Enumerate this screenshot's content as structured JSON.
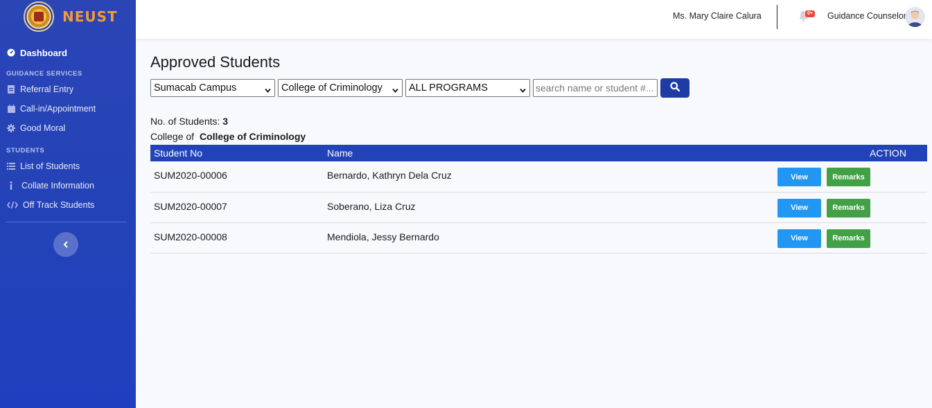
{
  "brand": {
    "name": "NEUST"
  },
  "sidebar": {
    "dashboard": "Dashboard",
    "sections": [
      {
        "heading": "GUIDANCE SERVICES",
        "items": [
          {
            "label": "Referral Entry",
            "icon": "file-icon"
          },
          {
            "label": "Call-in/Appointment",
            "icon": "calendar-icon"
          },
          {
            "label": "Good Moral",
            "icon": "gear-icon"
          }
        ]
      },
      {
        "heading": "STUDENTS",
        "items": [
          {
            "label": "List of Students",
            "icon": "list-icon"
          },
          {
            "label": "Collate Information",
            "icon": "info-icon"
          },
          {
            "label": "Off Track Students",
            "icon": "code-icon"
          }
        ]
      }
    ]
  },
  "topbar": {
    "user_name": "Ms. Mary Claire Calura",
    "notification_badge": "0+",
    "role": "Guidance Counselor"
  },
  "page": {
    "title": "Approved Students",
    "filters": {
      "campus": "Sumacab Campus",
      "college": "College of Criminology",
      "program": "ALL PROGRAMS",
      "search_placeholder": "search name or student #..."
    },
    "count_label": "No. of Students:",
    "count_value": "3",
    "college_label": "College of",
    "college_value": "College of Criminology"
  },
  "table": {
    "headers": {
      "student_no": "Student No",
      "name": "Name",
      "action": "ACTION"
    },
    "view_label": "View",
    "remarks_label": "Remarks",
    "rows": [
      {
        "student_no": "SUM2020-00006",
        "name": "Bernardo, Kathryn Dela Cruz"
      },
      {
        "student_no": "SUM2020-00007",
        "name": "Soberano, Liza Cruz"
      },
      {
        "student_no": "SUM2020-00008",
        "name": "Mendiola, Jessy Bernardo"
      }
    ]
  },
  "colors": {
    "sidebar": "#2242b8",
    "brand": "#f29b36",
    "view": "#2196f3",
    "remarks": "#43a047",
    "header": "#2242b8"
  }
}
